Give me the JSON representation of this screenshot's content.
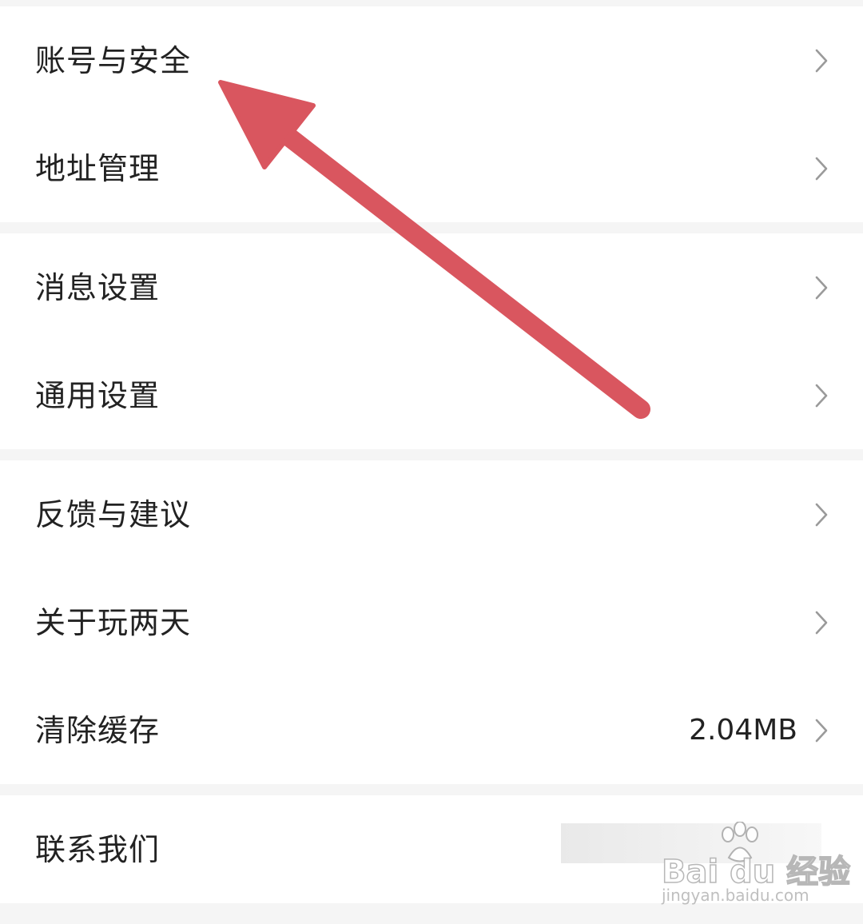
{
  "settings": {
    "group1": {
      "items": [
        {
          "label": "账号与安全"
        },
        {
          "label": "地址管理"
        }
      ]
    },
    "group2": {
      "items": [
        {
          "label": "消息设置"
        },
        {
          "label": "通用设置"
        }
      ]
    },
    "group3": {
      "items": [
        {
          "label": "反馈与建议"
        },
        {
          "label": "关于玩两天"
        },
        {
          "label": "清除缓存",
          "value": "2.04MB"
        }
      ]
    },
    "group4": {
      "items": [
        {
          "label": "联系我们"
        }
      ]
    }
  },
  "annotation": {
    "arrow_color": "#d9565f"
  },
  "watermark": {
    "brand": "Bai du 经验",
    "url": "jingyan.baidu.com"
  },
  "colors": {
    "page_background": "#f5f5f5",
    "row_background": "#ffffff",
    "text": "#222222",
    "chevron": "#9a9a9a"
  }
}
